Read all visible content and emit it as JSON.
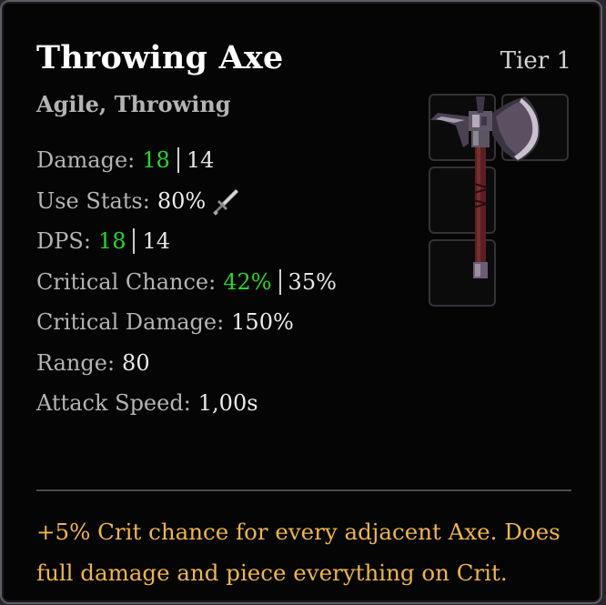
{
  "item": {
    "name": "Throwing Axe",
    "tier": "Tier 1",
    "tags": "Agile, Throwing"
  },
  "stats": [
    {
      "label": "Damage:",
      "value": "18",
      "highlight": true,
      "base": "14"
    },
    {
      "label": "Use Stats:",
      "value": "80%",
      "icon": "sword-icon"
    },
    {
      "label": "DPS:",
      "value": "18",
      "highlight": true,
      "base": "14"
    },
    {
      "label": "Critical Chance:",
      "value": "42%",
      "highlight": true,
      "base": "35%"
    },
    {
      "label": "Critical Damage:",
      "value": "150%"
    },
    {
      "label": "Range:",
      "value": "80"
    },
    {
      "label": "Attack Speed:",
      "value": "1,00s"
    }
  ],
  "effect": {
    "lines": [
      "+5% Crit chance for every adjacent Axe.  Does",
      "full damage and piece everything on Crit."
    ]
  },
  "colors": {
    "highlight": "#28d62a",
    "effect": "#f0b54a",
    "title": "#ffffff",
    "label": "#b4b4b4"
  },
  "inventory_shape": {
    "icon": "throwing-axe-icon"
  }
}
